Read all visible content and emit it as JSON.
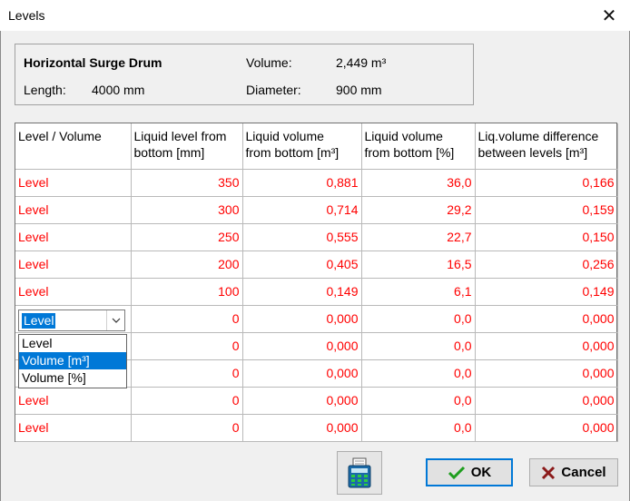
{
  "window": {
    "title": "Levels",
    "close_glyph": "✕"
  },
  "info": {
    "name": "Horizontal Surge Drum",
    "volume_label": "Volume:",
    "volume_value": "2,449 m³",
    "length_label": "Length:",
    "length_value": "4000 mm",
    "diameter_label": "Diameter:",
    "diameter_value": "900 mm"
  },
  "table": {
    "headers": [
      [
        "Level / Volume",
        ""
      ],
      [
        "Liquid level from",
        "bottom [mm]"
      ],
      [
        "Liquid volume",
        "from bottom [m³]"
      ],
      [
        "Liquid volume",
        "from bottom [%]"
      ],
      [
        "Liq.volume difference",
        "between levels [m³]"
      ]
    ],
    "rows": [
      [
        "Level",
        "350",
        "0,881",
        "36,0",
        "0,166"
      ],
      [
        "Level",
        "300",
        "0,714",
        "29,2",
        "0,159"
      ],
      [
        "Level",
        "250",
        "0,555",
        "22,7",
        "0,150"
      ],
      [
        "Level",
        "200",
        "0,405",
        "16,5",
        "0,256"
      ],
      [
        "Level",
        "100",
        "0,149",
        "6,1",
        "0,149"
      ],
      [
        "Level",
        "0",
        "0,000",
        "0,0",
        "0,000"
      ],
      [
        "",
        "0",
        "0,000",
        "0,0",
        "0,000"
      ],
      [
        "",
        "0",
        "0,000",
        "0,0",
        "0,000"
      ],
      [
        "Level",
        "0",
        "0,000",
        "0,0",
        "0,000"
      ],
      [
        "Level",
        "0",
        "0,000",
        "0,0",
        "0,000"
      ]
    ],
    "text_color": "#ff0000"
  },
  "dropdown": {
    "selected_value": "Level",
    "options": [
      "Level",
      "Volume [m³]",
      "Volume [%]"
    ],
    "highlighted_index": 1
  },
  "buttons": {
    "calculator_icon": "calculator-icon",
    "ok_label": "OK",
    "cancel_label": "Cancel"
  },
  "colors": {
    "accent": "#0078d7",
    "value_text": "#ff0000"
  }
}
